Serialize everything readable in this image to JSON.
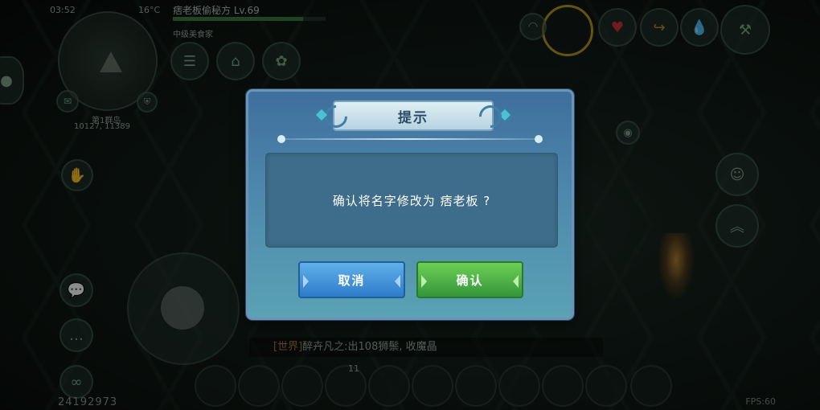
{
  "hud": {
    "time": "03:52",
    "temperature": "16°C",
    "player_name": "痞老板偷秘方 Lv.69",
    "hp_percent": 85,
    "guild": "中级美食家",
    "map_label": "第1群岛",
    "coordinates": "10127, 11389",
    "chat_channel": "[世界]",
    "chat_message": "醉卉凡之:出108狮鬃, 收魔晶",
    "score": "24192973",
    "fps": "FPS:60",
    "slot_count": "11"
  },
  "dialog": {
    "title": "提示",
    "message": "确认将名字修改为 痞老板 ?",
    "cancel_label": "取消",
    "confirm_label": "确认"
  },
  "colors": {
    "dialog_top": "#3f6f9d",
    "dialog_bottom": "#5aa2b4",
    "cancel_button": "#2e7cc9",
    "confirm_button": "#35963a"
  }
}
